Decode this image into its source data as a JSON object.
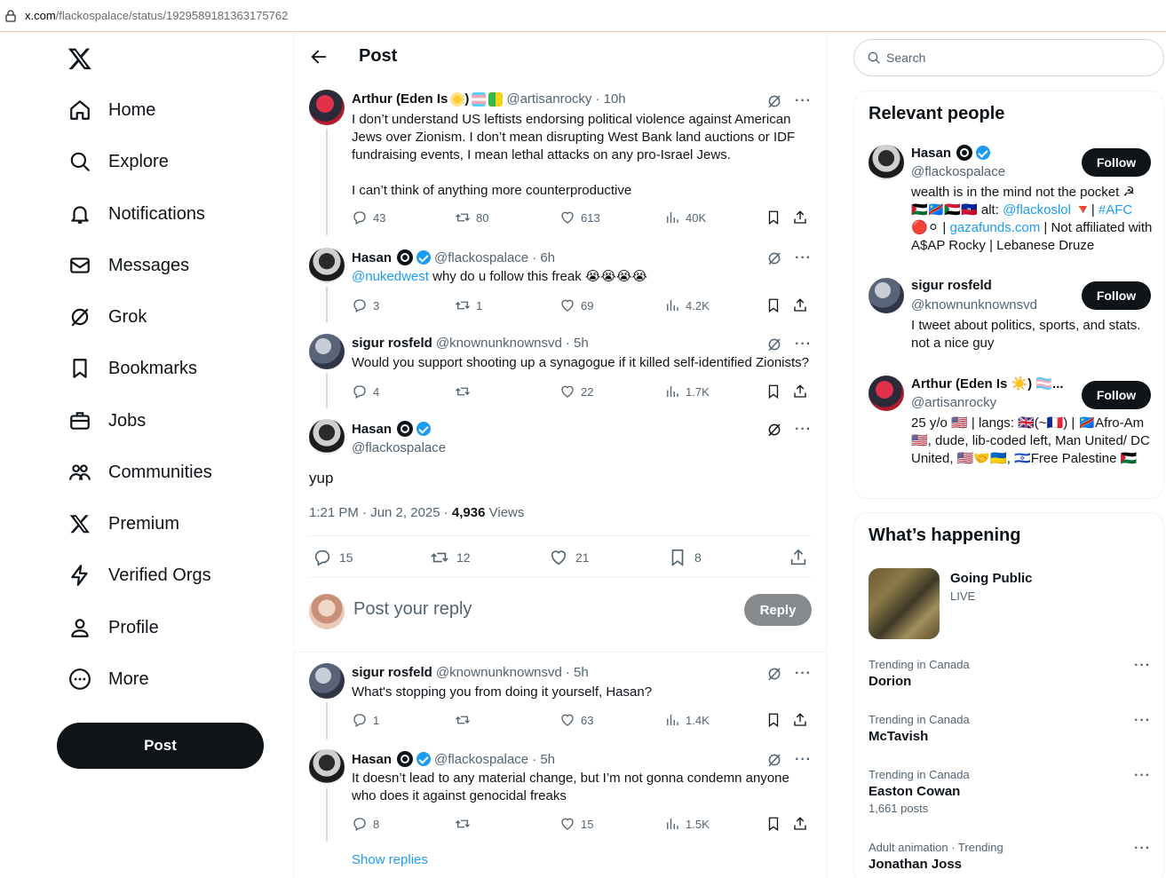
{
  "browser": {
    "url_host": "x.com",
    "url_path": "/flackospalace/status/1929589181363175762"
  },
  "nav": {
    "items": [
      {
        "label": "Home"
      },
      {
        "label": "Explore"
      },
      {
        "label": "Notifications"
      },
      {
        "label": "Messages"
      },
      {
        "label": "Grok"
      },
      {
        "label": "Bookmarks"
      },
      {
        "label": "Jobs"
      },
      {
        "label": "Communities"
      },
      {
        "label": "Premium"
      },
      {
        "label": "Verified Orgs"
      },
      {
        "label": "Profile"
      },
      {
        "label": "More"
      }
    ],
    "post_button": "Post"
  },
  "header": {
    "title": "Post"
  },
  "tweets": [
    {
      "name": "Arthur (Eden Is",
      "name_suffix": ")",
      "handle": "@artisanrocky",
      "time": "· 10h",
      "text1": "I don’t understand US leftists endorsing political violence against American Jews over Zionism. I don’t mean disrupting West Bank land auctions or IDF fundraising events, I mean lethal attacks on any pro-Israel Jews.",
      "text2": "I can’t think of anything more counterproductive",
      "replies": "43",
      "reposts": "80",
      "likes": "613",
      "views": "40K"
    },
    {
      "name": "Hasan",
      "handle": "@flackospalace",
      "time": "· 6h",
      "mention": "@nukedwest",
      "text": " why do u follow this freak 😭😭😭😭",
      "replies": "3",
      "reposts": "1",
      "likes": "69",
      "views": "4.2K"
    },
    {
      "name": "sigur rosfeld",
      "handle": "@knownunknownsvd",
      "time": "· 5h",
      "text": "Would you support shooting up a synagogue if it killed self-identified Zionists?",
      "replies": "4",
      "reposts": "",
      "likes": "22",
      "views": "1.7K"
    }
  ],
  "focus": {
    "name": "Hasan",
    "handle": "@flackospalace",
    "text": "yup",
    "time": "1:21 PM · Jun 2, 2025 · ",
    "views_count": "4,936",
    "views_label": " Views",
    "replies": "15",
    "reposts": "12",
    "likes": "21",
    "bookmarks": "8"
  },
  "reply_box": {
    "placeholder": "Post your reply",
    "button": "Reply"
  },
  "replies": [
    {
      "name": "sigur rosfeld",
      "handle": "@knownunknownsvd",
      "time": "· 5h",
      "text": "What's stopping you from doing it yourself, Hasan?",
      "replies": "1",
      "reposts": "",
      "likes": "63",
      "views": "1.4K"
    },
    {
      "name": "Hasan",
      "handle": "@flackospalace",
      "time": "· 5h",
      "text": "It doesn’t lead to any material change, but I’m not gonna condemn anyone who does it against genocidal freaks",
      "replies": "8",
      "reposts": "",
      "likes": "15",
      "views": "1.5K"
    }
  ],
  "show_replies": "Show replies",
  "search": {
    "placeholder": "Search"
  },
  "relevant": {
    "title": "Relevant people",
    "people": [
      {
        "name": "Hasan",
        "handle": "@flackospalace",
        "bio_a": "wealth is in the mind not the pocket ☭",
        "bio_b": "🇵🇸🇨🇩🇸🇩🇭🇹 alt: ",
        "bio_link1": "@flackoslol",
        "bio_c": " 🔻| ",
        "bio_link2": "#AFC",
        "bio_d": "🔴⚪ | ",
        "bio_link3": "gazafunds.com",
        "bio_e": " | Not affiliated with A$AP Rocky | Lebanese Druze",
        "follow": "Follow"
      },
      {
        "name": "sigur rosfeld",
        "handle": "@knownunknownsvd",
        "bio": "I tweet about politics, sports, and stats. not a nice guy",
        "follow": "Follow"
      },
      {
        "name": "Arthur (Eden Is ☀️) 🏳️‍⚧️...",
        "handle": "@artisanrocky",
        "bio": "25 y/o 🇺🇸 | langs: 🇬🇧(~🇫🇷) | 🇨🇩Afro-Am🇺🇸, dude, lib-coded left, Man United/ DC United, 🇺🇸🤝🇺🇦, 🇮🇱Free Palestine 🇵🇸",
        "follow": "Follow"
      }
    ]
  },
  "happening": {
    "title": "What’s happening",
    "live_title": "Going Public",
    "live_sub": "LIVE",
    "trends": [
      {
        "context": "Trending in Canada",
        "name": "Dorion",
        "count": ""
      },
      {
        "context": "Trending in Canada",
        "name": "McTavish",
        "count": ""
      },
      {
        "context": "Trending in Canada",
        "name": "Easton Cowan",
        "count": "1,661 posts"
      },
      {
        "context": "Adult animation · Trending",
        "name": "Jonathan Joss",
        "count": ""
      }
    ]
  }
}
